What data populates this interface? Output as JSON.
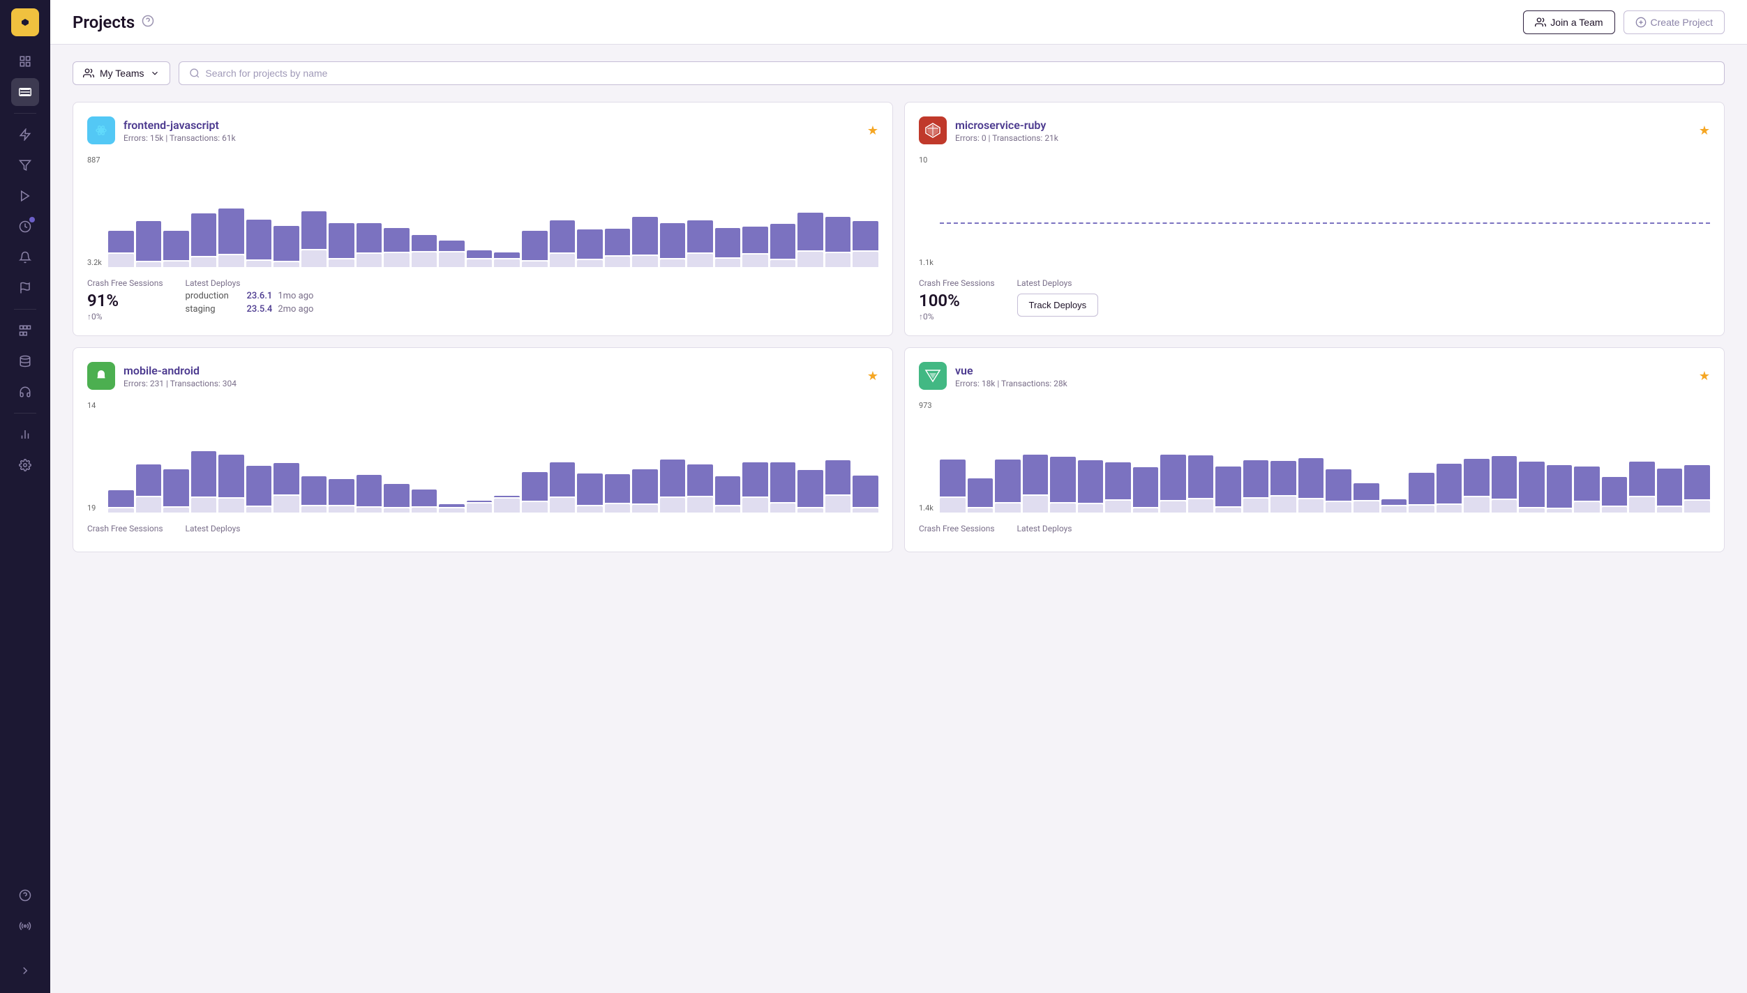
{
  "app": {
    "logo_symbol": "◆",
    "title": "Projects",
    "help_tooltip": "Help"
  },
  "header": {
    "title": "Projects",
    "join_label": "Join a Team",
    "create_label": "Create Project"
  },
  "sidebar": {
    "items": [
      {
        "name": "grid-icon",
        "label": "Dashboard",
        "active": false
      },
      {
        "name": "projects-icon",
        "label": "Projects",
        "active": true
      },
      {
        "name": "lightning-icon",
        "label": "Issues",
        "active": false
      },
      {
        "name": "filter-icon",
        "label": "Filters",
        "active": false
      },
      {
        "name": "play-icon",
        "label": "Replays",
        "active": false
      },
      {
        "name": "clock-icon",
        "label": "Crons",
        "active": false,
        "dot": true
      },
      {
        "name": "bell-icon",
        "label": "Alerts",
        "active": false
      },
      {
        "name": "flag-icon",
        "label": "Feature Flags",
        "active": false
      },
      {
        "name": "modules-icon",
        "label": "Modules",
        "active": false
      },
      {
        "name": "storage-icon",
        "label": "Storage",
        "active": false
      },
      {
        "name": "headphones-icon",
        "label": "Support",
        "active": false
      },
      {
        "name": "chart-icon",
        "label": "Stats",
        "active": false
      },
      {
        "name": "settings-icon",
        "label": "Settings",
        "active": false
      }
    ],
    "bottom_items": [
      {
        "name": "help-icon",
        "label": "Help"
      },
      {
        "name": "broadcast-icon",
        "label": "Broadcasts"
      }
    ]
  },
  "filters": {
    "team_label": "My Teams",
    "search_placeholder": "Search for projects by name"
  },
  "projects": [
    {
      "id": "frontend-javascript",
      "name": "frontend-javascript",
      "icon_type": "react",
      "errors": "15k",
      "transactions": "61k",
      "starred": true,
      "chart_top_label": "887",
      "chart_bottom_label": "3.2k",
      "crash_free_label": "Crash Free Sessions",
      "crash_free_value": "91%",
      "crash_free_change": "↑0%",
      "deploys_label": "Latest Deploys",
      "deploys": [
        {
          "env": "production",
          "version": "23.6.1",
          "time": "1mo ago"
        },
        {
          "env": "staging",
          "version": "23.5.4",
          "time": "2mo ago"
        }
      ],
      "bars": [
        40,
        75,
        55,
        80,
        85,
        75,
        65,
        70,
        65,
        55,
        45,
        30,
        20,
        15,
        10,
        55,
        60,
        55,
        50,
        70,
        65,
        60,
        55,
        50,
        65,
        70,
        65,
        55
      ]
    },
    {
      "id": "microservice-ruby",
      "name": "microservice-ruby",
      "icon_type": "ruby",
      "errors": "0",
      "transactions": "21k",
      "starred": true,
      "chart_top_label": "10",
      "chart_bottom_label": "1.1k",
      "crash_free_label": "Crash Free Sessions",
      "crash_free_value": "100%",
      "crash_free_change": "↑0%",
      "deploys_label": "Latest Deploys",
      "deploys": [],
      "track_deploys_label": "Track Deploys",
      "bars": []
    },
    {
      "id": "mobile-android",
      "name": "mobile-android",
      "icon_type": "android",
      "errors": "231",
      "transactions": "304",
      "starred": true,
      "chart_top_label": "14",
      "chart_bottom_label": "19",
      "crash_free_label": "Crash Free Sessions",
      "crash_free_value": "",
      "crash_free_change": "",
      "deploys_label": "Latest Deploys",
      "deploys": [],
      "bars": [
        30,
        55,
        65,
        80,
        75,
        70,
        55,
        50,
        45,
        55,
        40,
        30,
        5,
        0,
        0,
        50,
        60,
        55,
        50,
        60,
        65,
        55,
        50,
        60,
        70,
        65,
        60,
        55
      ]
    },
    {
      "id": "vue",
      "name": "vue",
      "icon_type": "vue",
      "errors": "18k",
      "transactions": "28k",
      "starred": true,
      "chart_top_label": "973",
      "chart_bottom_label": "1.4k",
      "crash_free_label": "Crash Free Sessions",
      "crash_free_value": "",
      "crash_free_change": "",
      "deploys_label": "Latest Deploys",
      "deploys": [],
      "bars": [
        65,
        50,
        75,
        70,
        80,
        75,
        65,
        70,
        80,
        75,
        70,
        65,
        60,
        70,
        55,
        30,
        10,
        55,
        70,
        65,
        75,
        80,
        75,
        60,
        50,
        60,
        65,
        60
      ]
    }
  ]
}
